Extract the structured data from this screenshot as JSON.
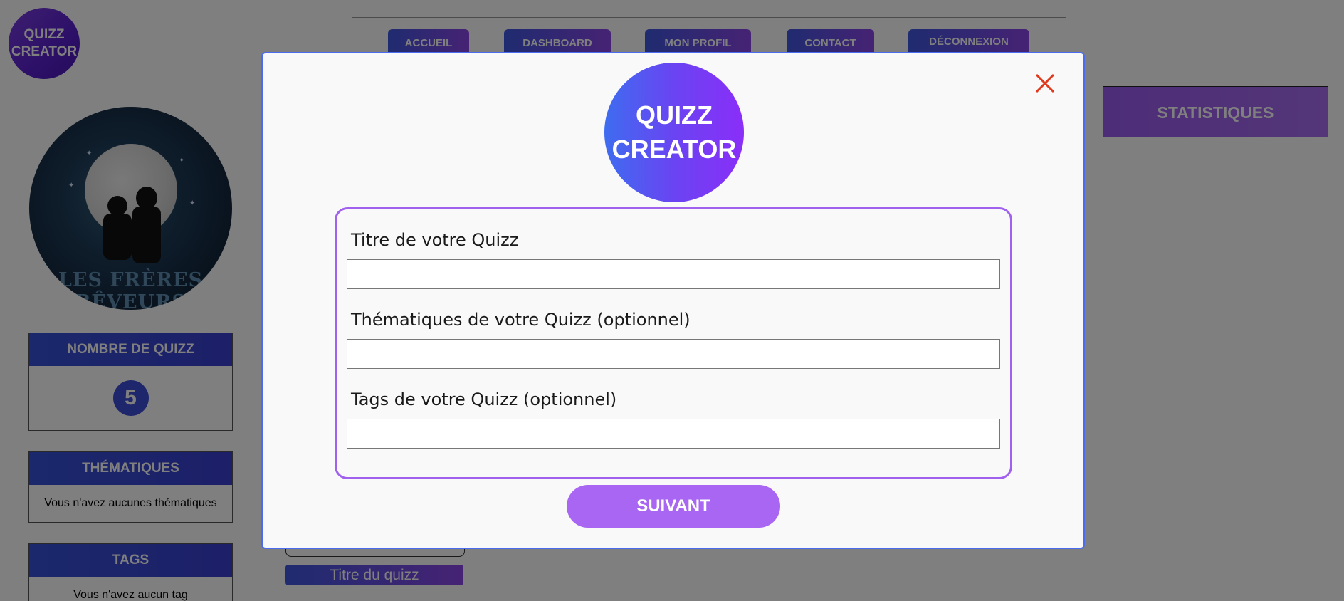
{
  "app": {
    "logo_line1": "QUIZZ",
    "logo_line2": "CREATOR"
  },
  "nav": {
    "items": [
      {
        "label": "ACCUEIL"
      },
      {
        "label": "DASHBOARD"
      },
      {
        "label": "MON PROFIL"
      },
      {
        "label": "CONTACT"
      },
      {
        "label": "DÉCONNEXION"
      }
    ]
  },
  "profile": {
    "avatar_brand": "LES FRÈRES RÊVEURS"
  },
  "sidebar": {
    "quiz_count": {
      "title": "NOMBRE DE QUIZZ",
      "value": "5"
    },
    "themes": {
      "title": "THÉMATIQUES",
      "text": "Vous n'avez aucunes thématiques"
    },
    "tags": {
      "title": "TAGS",
      "text": "Vous n'avez aucun tag"
    }
  },
  "stats": {
    "title": "STATISTIQUES"
  },
  "content": {
    "quiz_title_button": "Titre du quizz"
  },
  "modal": {
    "logo_line1": "QUIZZ",
    "logo_line2": "CREATOR",
    "fields": [
      {
        "label": "Titre de votre Quizz",
        "value": "",
        "placeholder": ""
      },
      {
        "label": "Thématiques de votre Quizz (optionnel)",
        "value": "",
        "placeholder": ""
      },
      {
        "label": "Tags de votre Quizz (optionnel)",
        "value": "",
        "placeholder": ""
      }
    ],
    "next_label": "SUIVANT",
    "close_icon": "close-icon"
  },
  "colors": {
    "accent_blue": "#3f57e0",
    "accent_purple": "#a866f2",
    "close_red": "#e03a1e",
    "form_border": "#a062ee"
  }
}
